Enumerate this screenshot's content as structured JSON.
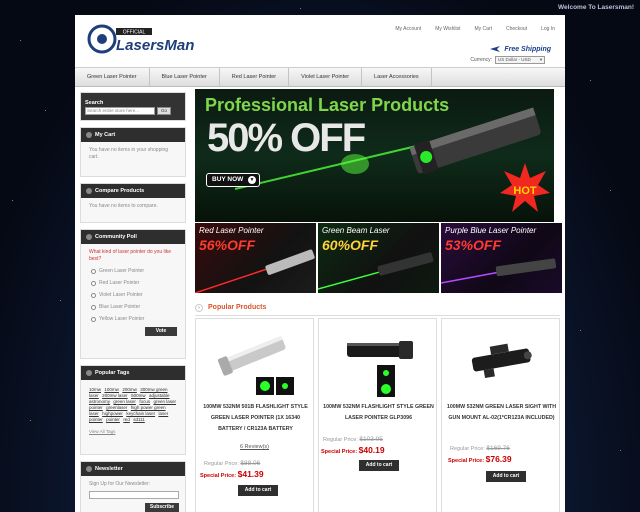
{
  "welcome": "Welcome To Lasersman!",
  "header": {
    "logo_text": "LasersMan",
    "logo_badge": "OFFICIAL",
    "links": [
      "My Account",
      "My Wishlist",
      "My Cart",
      "Checkout",
      "Log In"
    ],
    "free_shipping": "Free Shipping",
    "currency_label": "Currency:",
    "currency_value": "US Dollar - USD"
  },
  "nav": [
    "Green Laser Pointer",
    "Blue Laser Pointer",
    "Red Laser Pointer",
    "Violet Laser Pointer",
    "Laser Accessories"
  ],
  "sidebar": {
    "search": {
      "label": "Search",
      "placeholder": "Search entire store here...",
      "button": "Go"
    },
    "cart": {
      "title": "My Cart",
      "text": "You have no items in your shopping cart."
    },
    "compare": {
      "title": "Compare Products",
      "text": "You have no items to compare."
    },
    "poll": {
      "title": "Community Poll",
      "question": "What kind of laser pointer do you like best?",
      "options": [
        "Green Laser Pointer",
        "Red Laser Pointer",
        "Violet Laser Pointer",
        "Blue Laser Pointer",
        "Yellow Laser Pointer"
      ],
      "button": "Vote"
    },
    "tags": {
      "title": "Popular Tags",
      "items": [
        "10mw",
        "100mw",
        "200mw",
        "300mw green laser",
        "200mw laser",
        "500mw",
        "adjustable",
        "astronomy",
        "green laser",
        "focus",
        "green laser pointer",
        "greenlaser",
        "high power green laser",
        "highpower",
        "keychain laser",
        "laser pointer",
        "pointer",
        "red",
        "sd111"
      ],
      "view_all": "View All Tags"
    },
    "newsletter": {
      "title": "Newsletter",
      "label": "Sign Up for Our Newsletter:",
      "button": "Subscribe"
    }
  },
  "banner": {
    "title": "Professional Laser Products",
    "off": "50% OFF",
    "buy": "BUY NOW",
    "hot": "HOT"
  },
  "promos": [
    {
      "title": "Red Laser Pointer",
      "off": "56%OFF",
      "color": "#ff3b2f"
    },
    {
      "title": "Green Beam Laser",
      "off": "60%OFF",
      "color": "#ffd23a"
    },
    {
      "title": "Purple Blue Laser Pointer",
      "off": "53%OFF",
      "color": "#ff3b2f"
    }
  ],
  "popular_title": "Popular Products",
  "products": [
    {
      "name": "100mW 532nm 501B Flashlight Style Green Laser Pointer (1x 16340 Battery / CR123A Battery",
      "reviews": "6 Review(s)",
      "regular_label": "Regular Price:",
      "regular": "$88.06",
      "special_label": "Special Price:",
      "special": "$41.39",
      "button": "Add to cart"
    },
    {
      "name": "100mW 532nm Flashlight Style Green Laser Pointer GLP3096",
      "reviews": "",
      "regular_label": "Regular Price:",
      "regular": "$103.05",
      "special_label": "Special Price:",
      "special": "$40.19",
      "button": "Add to cart"
    },
    {
      "name": "100mW 532nm Green Laser Sight with Gun Mount AL-02(1*CR123A included)",
      "reviews": "",
      "regular_label": "Regular Price:",
      "regular": "$169.76",
      "special_label": "Special Price:",
      "special": "$76.39",
      "button": "Add to cart"
    }
  ]
}
